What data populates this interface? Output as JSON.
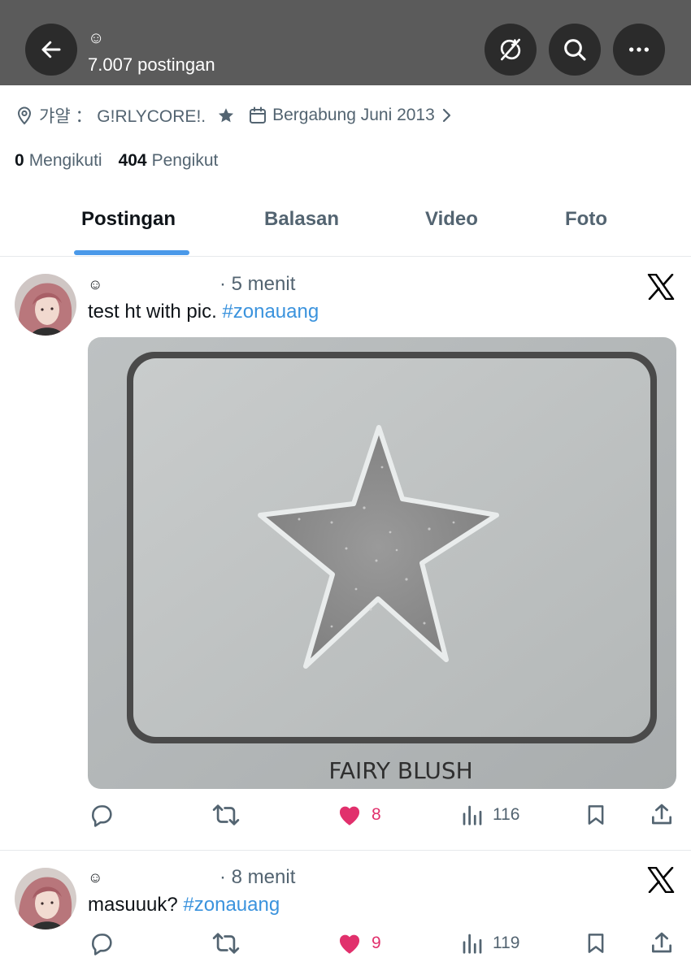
{
  "header": {
    "display_name": "☺",
    "post_count": "7.007 postingan",
    "back_icon": "arrow-left-icon",
    "sync_icon": "sync-off-icon",
    "search_icon": "search-icon",
    "more_icon": "more-horizontal-icon",
    "bar_color": "#5b5b5b",
    "button_color": "#2b2b2b"
  },
  "profile": {
    "location": "갸얄 ： G!RLYCORE!.",
    "location_icon": "location-pin-icon",
    "star_icon": "star-icon",
    "joined": "Bergabung Juni 2013",
    "joined_icon": "calendar-icon",
    "joined_chevron_icon": "chevron-right-icon",
    "following_count": "0",
    "following_label": "Mengikuti",
    "followers_count": "404",
    "followers_label": "Pengikut"
  },
  "tabs": [
    {
      "label": "Postingan",
      "active": true
    },
    {
      "label": "Balasan",
      "active": false
    },
    {
      "label": "Video",
      "active": false
    },
    {
      "label": "Foto",
      "active": false
    }
  ],
  "accent_color": "#4a99e9",
  "posts": [
    {
      "name": "☺",
      "time": "· 5 menit",
      "text": "test ht with pic. ",
      "hashtag": "#zonauang",
      "image_caption": "FAIRY BLUSH",
      "replies": "",
      "reposts": "",
      "likes": "8",
      "views": "116"
    },
    {
      "name": "☺",
      "time": "· 8 menit",
      "text": "masuuuk? ",
      "hashtag": "#zonauang",
      "replies": "",
      "reposts": "",
      "likes": "9",
      "views": "119"
    }
  ],
  "colors": {
    "hashtag": "#3b93dd",
    "like": "#e1306c",
    "muted": "#536471"
  }
}
